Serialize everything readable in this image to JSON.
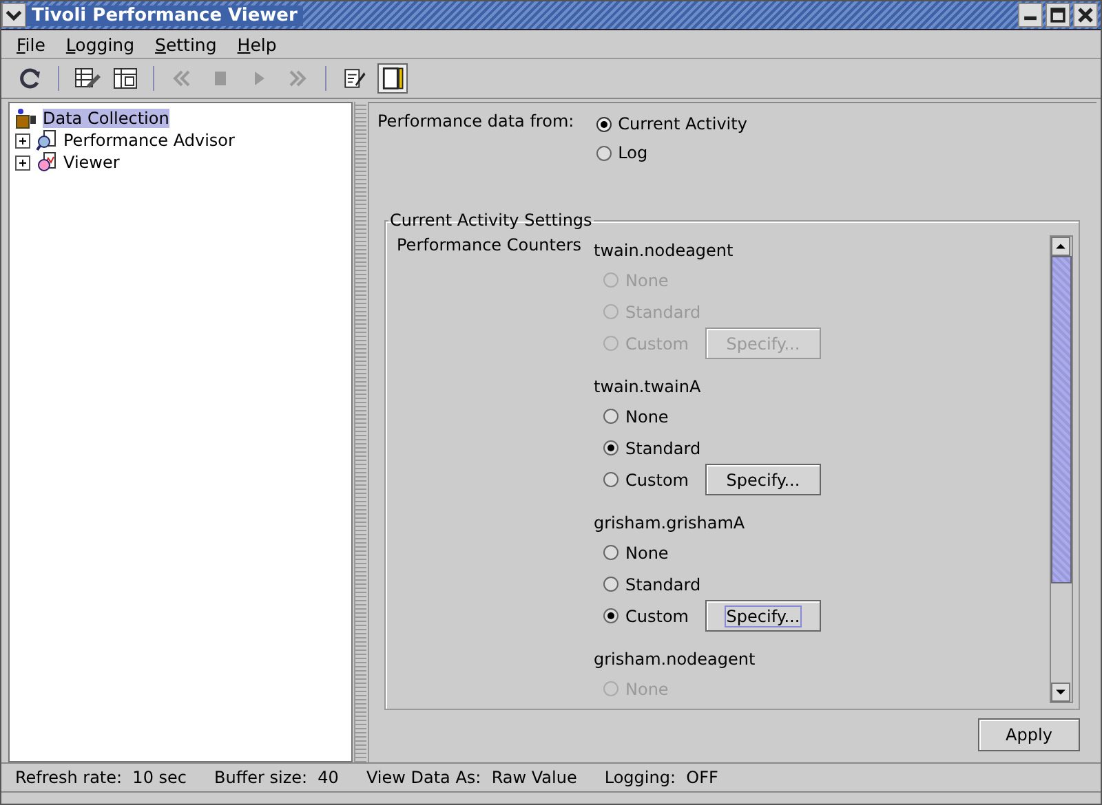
{
  "window": {
    "title": "Tivoli Performance Viewer"
  },
  "menu": [
    {
      "label": "File"
    },
    {
      "label": "Logging"
    },
    {
      "label": "Setting"
    },
    {
      "label": "Help"
    }
  ],
  "toolbar": [
    {
      "kind": "refresh"
    },
    {
      "kind": "sep"
    },
    {
      "kind": "edit-table"
    },
    {
      "kind": "snapshot"
    },
    {
      "kind": "sep"
    },
    {
      "kind": "rewind",
      "disabled": true
    },
    {
      "kind": "stop",
      "disabled": true
    },
    {
      "kind": "play",
      "disabled": true
    },
    {
      "kind": "forward",
      "disabled": true
    },
    {
      "kind": "sep"
    },
    {
      "kind": "notes",
      "selected": false
    },
    {
      "kind": "chart-view",
      "selected": true
    }
  ],
  "tree": {
    "label": "Data Collection",
    "selected": true,
    "children": [
      {
        "label": "Performance Advisor",
        "kind": "advisor",
        "expanded": false
      },
      {
        "label": "Viewer",
        "kind": "viewer",
        "expanded": false
      }
    ]
  },
  "source": {
    "label": "Performance data from:",
    "options": [
      {
        "label": "Current Activity",
        "selected": true
      },
      {
        "label": "Log",
        "selected": false
      }
    ]
  },
  "settings": {
    "title": "Current Activity Settings",
    "label": "Performance Counters",
    "groups": [
      {
        "name": "twain.nodeagent",
        "disabled": true,
        "options": [
          {
            "label": "None",
            "selected": false
          },
          {
            "label": "Standard",
            "selected": false
          },
          {
            "label": "Custom",
            "selected": false,
            "button": "Specify...",
            "focused": false
          }
        ]
      },
      {
        "name": "twain.twainA",
        "disabled": false,
        "options": [
          {
            "label": "None",
            "selected": false
          },
          {
            "label": "Standard",
            "selected": true
          },
          {
            "label": "Custom",
            "selected": false,
            "button": "Specify...",
            "focused": false
          }
        ]
      },
      {
        "name": "grisham.grishamA",
        "disabled": false,
        "options": [
          {
            "label": "None",
            "selected": false
          },
          {
            "label": "Standard",
            "selected": false
          },
          {
            "label": "Custom",
            "selected": true,
            "button": "Specify...",
            "focused": true
          }
        ]
      },
      {
        "name": "grisham.nodeagent",
        "disabled": true,
        "options": [
          {
            "label": "None",
            "selected": false
          }
        ]
      }
    ]
  },
  "apply": "Apply",
  "status_bar": [
    "Refresh rate:  10 sec",
    "Buffer size:  40",
    "View Data As:  Raw Value",
    "Logging:  OFF"
  ]
}
